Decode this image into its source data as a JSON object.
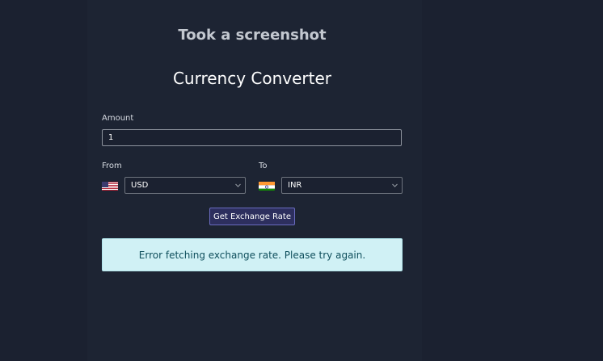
{
  "page": {
    "screenshot_title": "Took a screenshot",
    "app_title": "Currency Converter"
  },
  "amount": {
    "label": "Amount",
    "value": "1"
  },
  "from": {
    "label": "From",
    "flag": "us-flag-icon",
    "currency": "USD"
  },
  "to": {
    "label": "To",
    "flag": "india-flag-icon",
    "currency": "INR"
  },
  "convert_button": {
    "label": "Get Exchange Rate"
  },
  "alert": {
    "message": "Error fetching exchange rate. Please try again."
  },
  "colors": {
    "background": "#1b2130",
    "button": "#2d2f5e",
    "alert_background": "#d0f1f5",
    "alert_text": "#0f4f5c"
  }
}
